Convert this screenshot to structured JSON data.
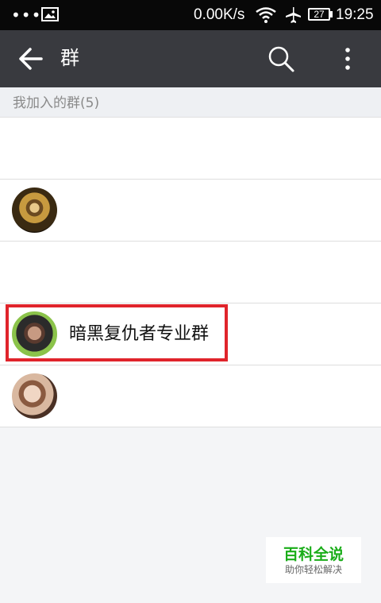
{
  "statusbar": {
    "dots": "•••",
    "speed": "0.00K/s",
    "battery": "27",
    "time": "19:25"
  },
  "toolbar": {
    "title": "群"
  },
  "section": {
    "label": "我加入的群(5)"
  },
  "groups": [
    {
      "name": ""
    },
    {
      "name": ""
    },
    {
      "name": ""
    },
    {
      "name": "暗黑复仇者专业群"
    },
    {
      "name": ""
    }
  ],
  "watermark": {
    "main": "百科全说",
    "sub": "助你轻松解决"
  },
  "colors": {
    "toolbar": "#393a3f",
    "highlight": "#e0242b",
    "watermark_green": "#1aad19"
  }
}
